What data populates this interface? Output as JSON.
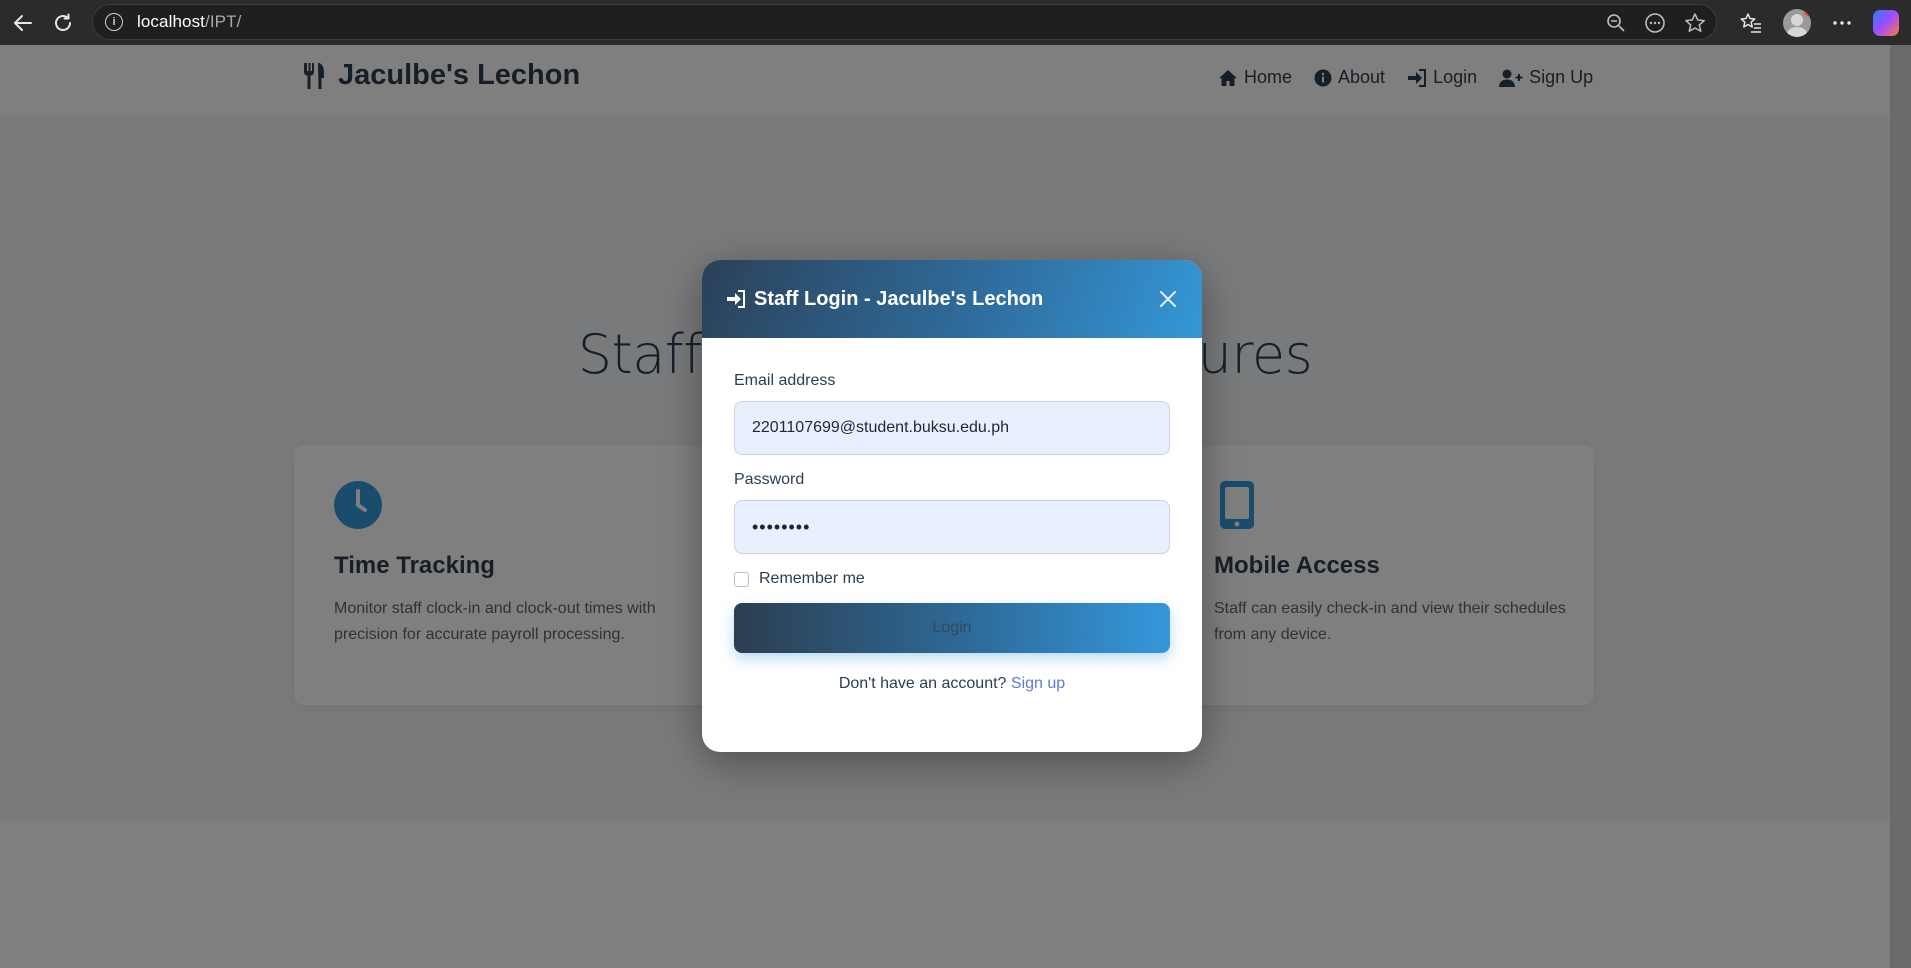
{
  "browser": {
    "url_host": "localhost",
    "url_path": "/IPT/"
  },
  "site": {
    "brand": "Jaculbe's Lechon",
    "nav": [
      {
        "label": "Home",
        "icon": "home-icon"
      },
      {
        "label": "About",
        "icon": "info-icon"
      },
      {
        "label": "Login",
        "icon": "sign-in-icon"
      },
      {
        "label": "Sign Up",
        "icon": "user-plus-icon"
      }
    ]
  },
  "hero": {
    "title": "Staff Management Features"
  },
  "features": [
    {
      "title": "Time Tracking",
      "description": "Monitor staff clock-in and clock-out times with precision for accurate payroll processing.",
      "icon": "clock-icon"
    },
    {
      "title": "Mobile Access",
      "description": "Staff can easily check-in and view their schedules from any device.",
      "icon": "mobile-icon"
    }
  ],
  "modal": {
    "title": "Staff Login - Jaculbe's Lechon",
    "email_label": "Email address",
    "email_value": "2201107699@student.buksu.edu.ph",
    "password_label": "Password",
    "password_value": "••••••••",
    "remember_label": "Remember me",
    "login_label": "Login",
    "signup_prompt": "Don't have an account?",
    "signup_link": "Sign up"
  },
  "colors": {
    "primary_dark": "#2c3e50",
    "primary_blue": "#3498db",
    "link": "#5b7bd6"
  }
}
